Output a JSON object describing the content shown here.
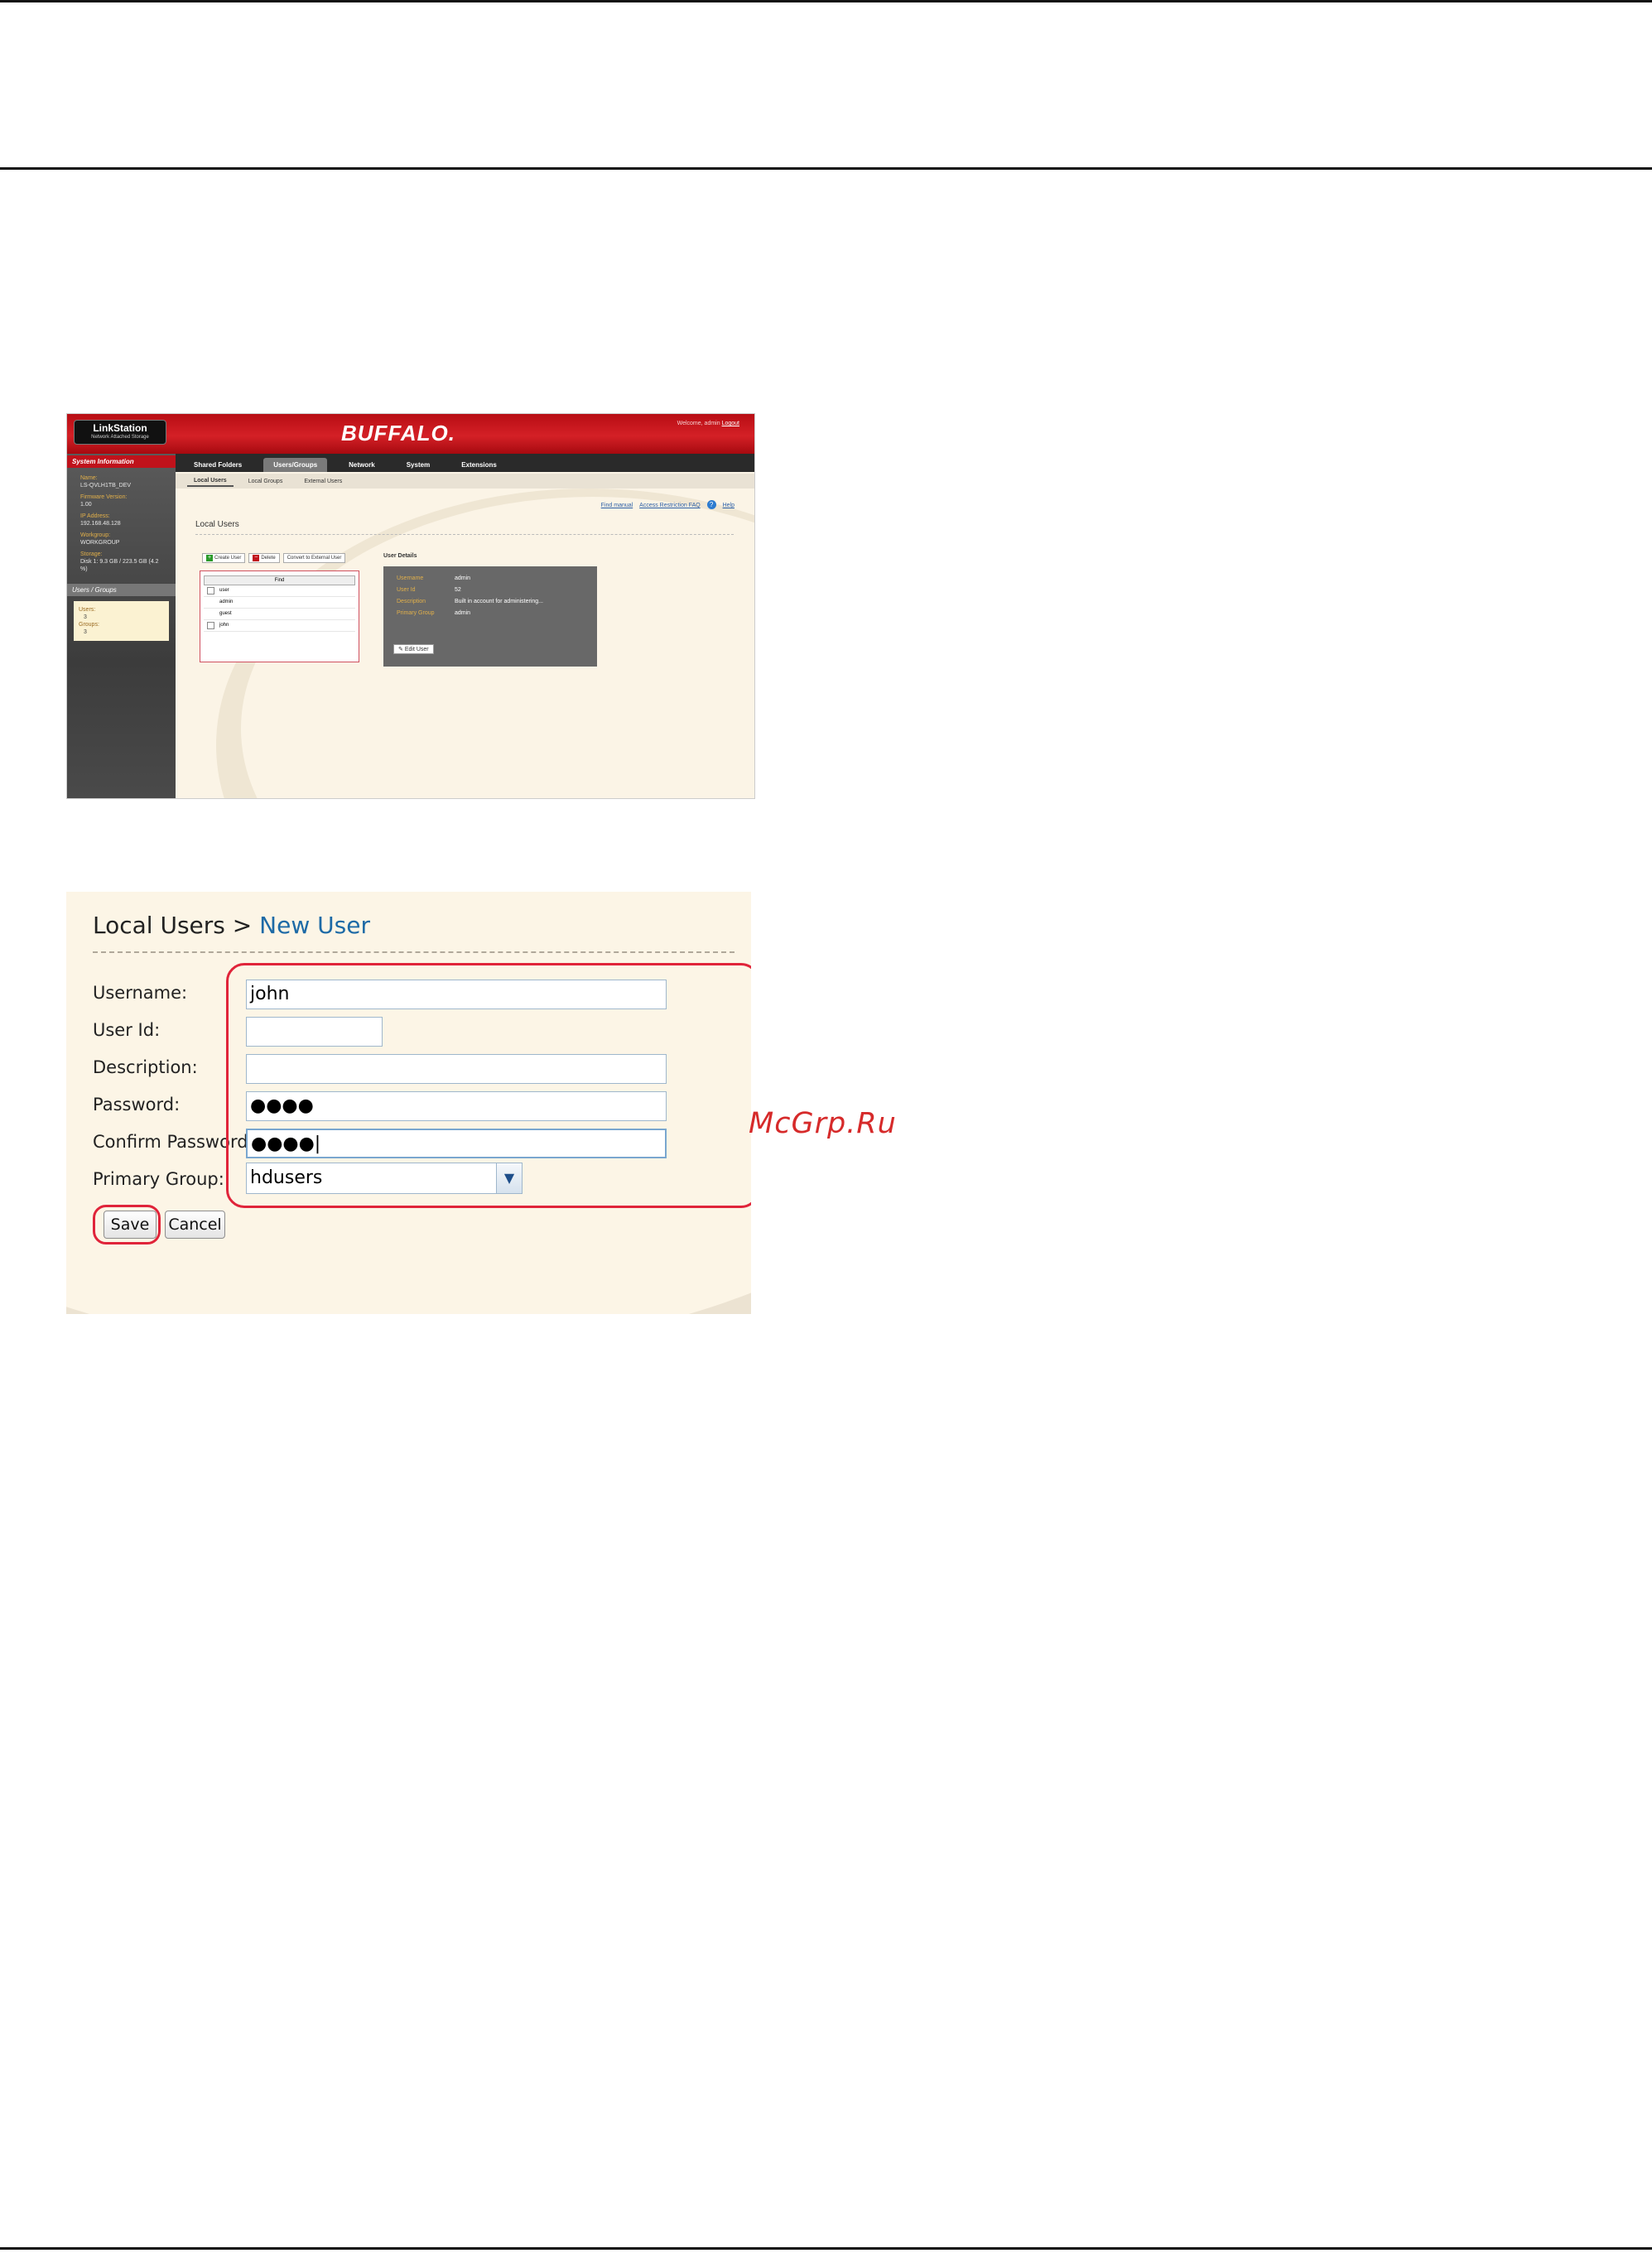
{
  "admin_screenshot": {
    "product_logo": {
      "line1": "LinkStation",
      "line2": "Network Attached Storage"
    },
    "brand": "BUFFALO.",
    "welcome": {
      "text": "Welcome, admin",
      "logout": "Logout"
    },
    "sidebar": {
      "header": "System Information",
      "info": [
        {
          "key": "Name:",
          "value": "LS-QVLH1TB_DEV"
        },
        {
          "key": "Firmware Version:",
          "value": "1.00"
        },
        {
          "key": "IP Address:",
          "value": "192.168.48.128"
        },
        {
          "key": "Workgroup:",
          "value": "WORKGROUP"
        },
        {
          "key": "Storage:",
          "value": "Disk 1: 9.3 GB / 223.5 GB (4.2 %)"
        }
      ],
      "users_groups_header": "Users / Groups",
      "users_label": "Users:",
      "users_count": "3",
      "groups_label": "Groups:",
      "groups_count": "3"
    },
    "tabs": [
      "Shared Folders",
      "Users/Groups",
      "Network",
      "System",
      "Extensions"
    ],
    "active_tab": "Users/Groups",
    "subtabs": [
      "Local Users",
      "Local Groups",
      "External Users"
    ],
    "active_subtab": "Local Users",
    "help_links": {
      "manual": "Find manual",
      "faq": "Access Restriction FAQ",
      "help": "Help"
    },
    "section_title": "Local Users",
    "buttons": {
      "create": "Create User",
      "delete": "Delete",
      "convert": "Convert to External User"
    },
    "list_header": "Find",
    "users": [
      "user",
      "admin",
      "guest",
      "john"
    ],
    "details_title": "User Details",
    "details": [
      {
        "key": "Username",
        "value": "admin"
      },
      {
        "key": "User Id",
        "value": "52"
      },
      {
        "key": "Description",
        "value": "Built in account for administering..."
      },
      {
        "key": "Primary Group",
        "value": "admin"
      }
    ],
    "edit_button": "Edit User"
  },
  "new_user_form": {
    "breadcrumb_root": "Local Users",
    "separator": " > ",
    "breadcrumb_current": "New User",
    "labels": {
      "username": "Username:",
      "user_id": "User Id:",
      "description": "Description:",
      "password": "Password:",
      "confirm_password": "Confirm Password:",
      "primary_group": "Primary Group:"
    },
    "values": {
      "username": "john",
      "user_id": "",
      "description": "",
      "password": "●●●●",
      "confirm_password": "●●●●|",
      "primary_group": "hdusers"
    },
    "save_label": "Save",
    "cancel_label": "Cancel"
  },
  "watermark": "McGrp.Ru",
  "colors": {
    "highlight": "#e0243a",
    "brand_red": "#c0121b",
    "link_blue": "#1d6aa6"
  }
}
